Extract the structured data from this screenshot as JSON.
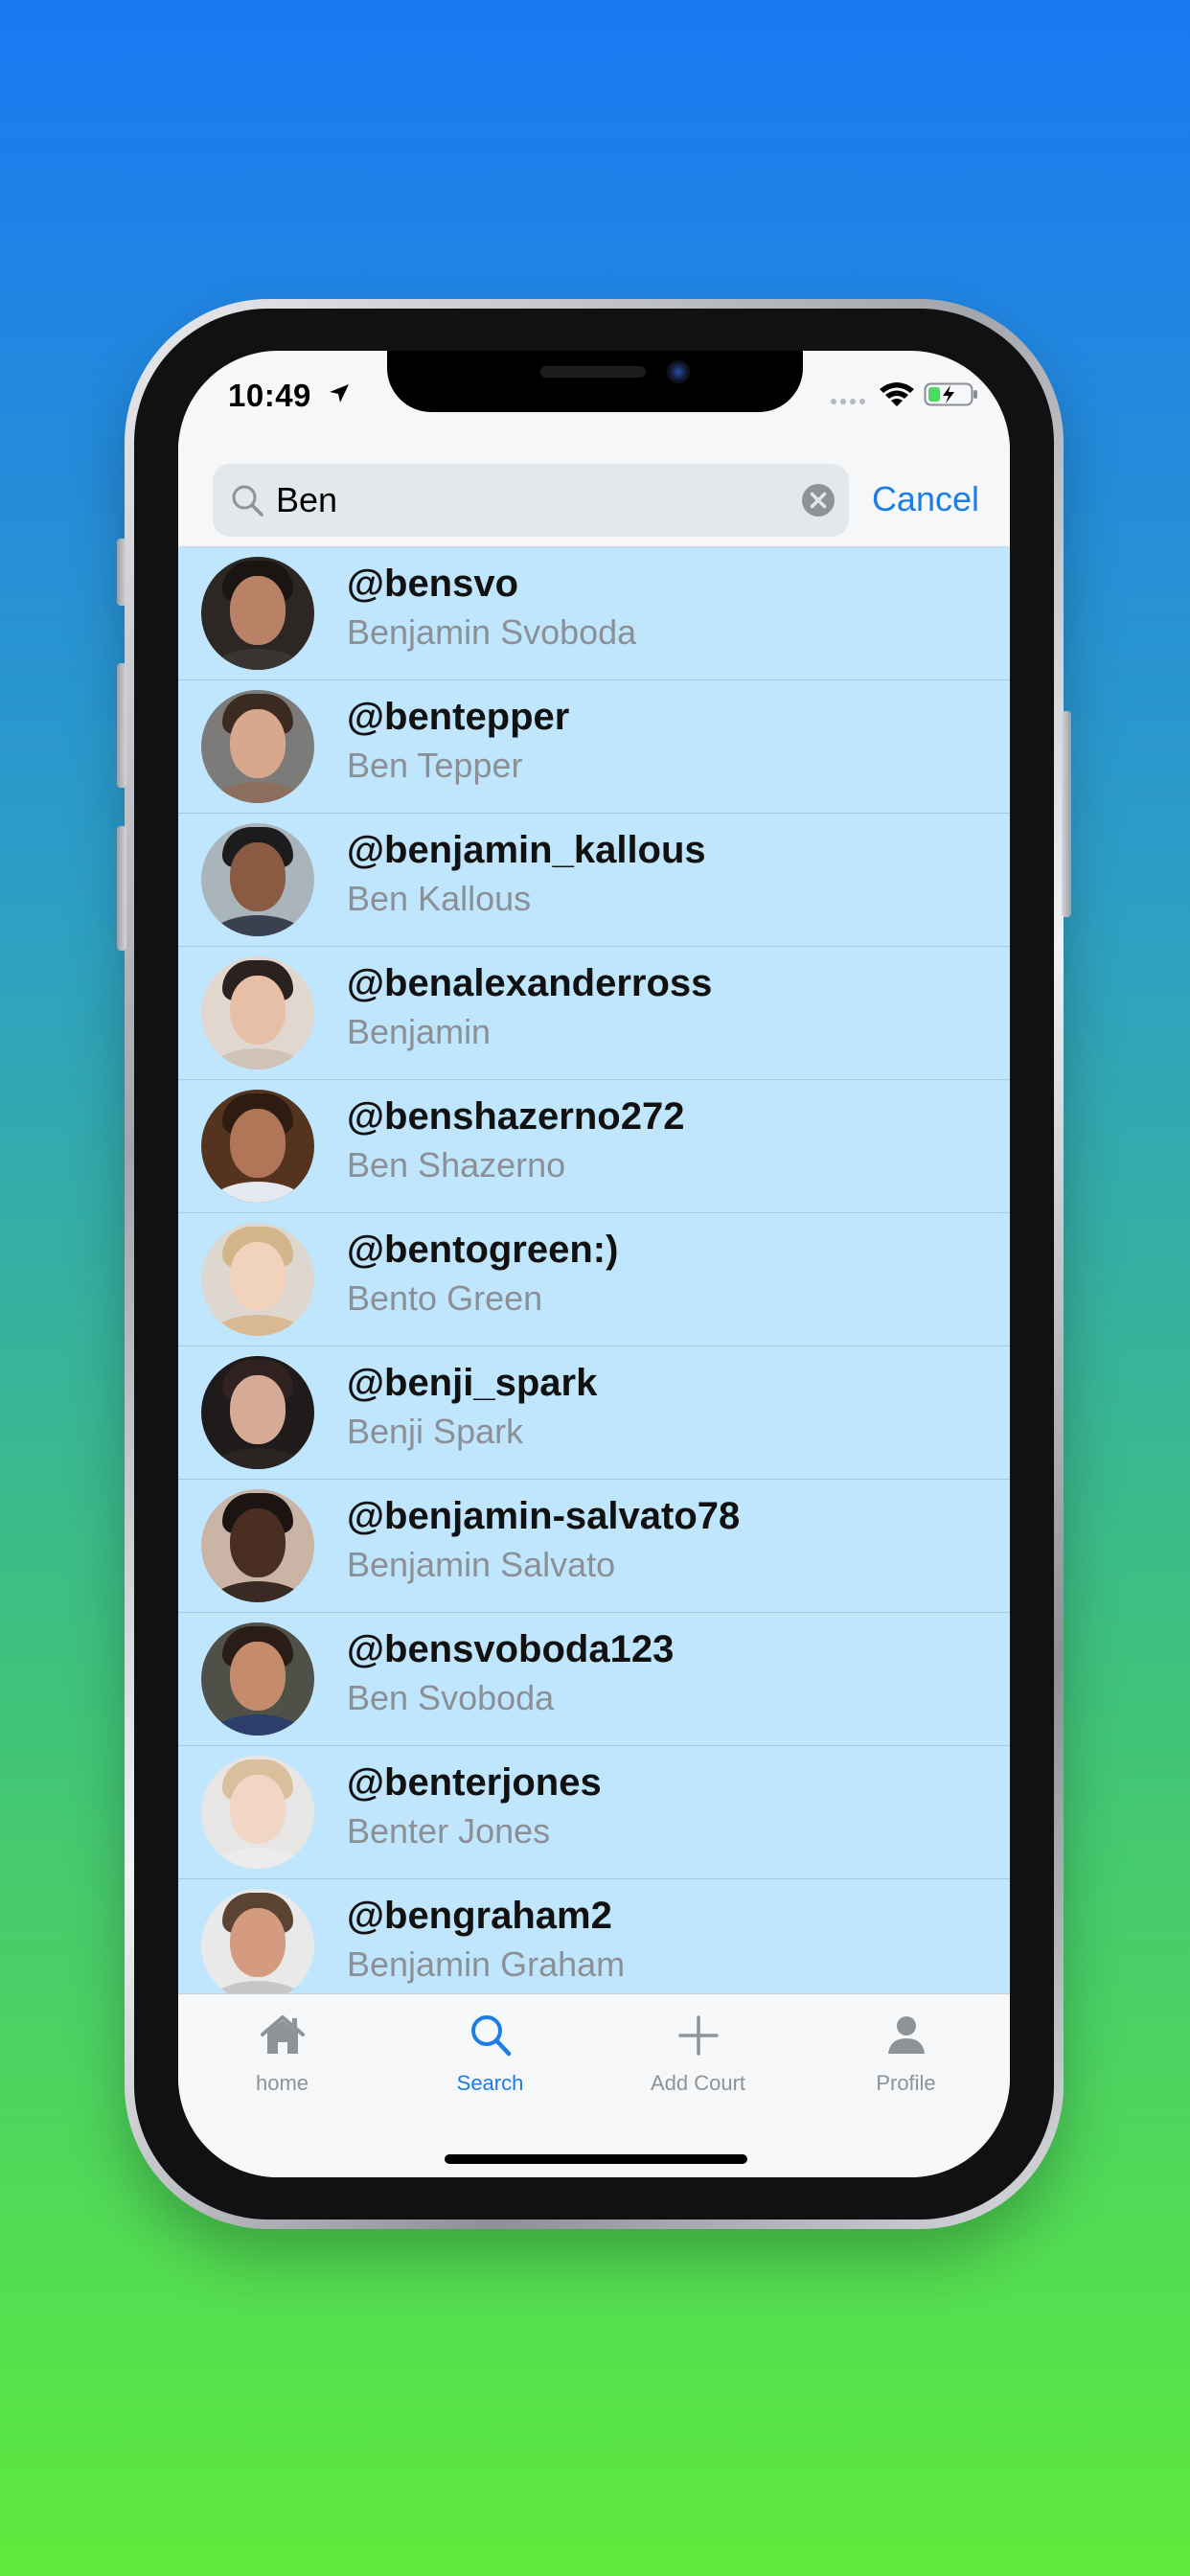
{
  "status_bar": {
    "time": "10:49"
  },
  "search": {
    "value": "Ben",
    "cancel_label": "Cancel"
  },
  "results": [
    {
      "username": "@bensvo",
      "name": "Benjamin Svoboda"
    },
    {
      "username": "@bentepper",
      "name": "Ben Tepper"
    },
    {
      "username": "@benjamin_kallous",
      "name": "Ben Kallous"
    },
    {
      "username": "@benalexanderross",
      "name": "Benjamin"
    },
    {
      "username": "@benshazerno272",
      "name": "Ben Shazerno"
    },
    {
      "username": "@bentogreen:)",
      "name": "Bento Green"
    },
    {
      "username": "@benji_spark",
      "name": "Benji Spark"
    },
    {
      "username": "@benjamin-salvato78",
      "name": "Benjamin Salvato"
    },
    {
      "username": "@bensvoboda123",
      "name": "Ben Svoboda"
    },
    {
      "username": "@benterjones",
      "name": "Benter Jones"
    },
    {
      "username": "@bengraham2",
      "name": "Benjamin Graham"
    }
  ],
  "tab_bar": {
    "tabs": [
      {
        "label": "home",
        "icon": "house-icon",
        "active": false
      },
      {
        "label": "Search",
        "icon": "search-icon",
        "active": true
      },
      {
        "label": "Add Court",
        "icon": "plus-icon",
        "active": false
      },
      {
        "label": "Profile",
        "icon": "person-icon",
        "active": false
      }
    ]
  },
  "colors": {
    "accent": "#1b7de5",
    "list_background": "#bfe6fd",
    "secondary_text": "#8a9096"
  }
}
